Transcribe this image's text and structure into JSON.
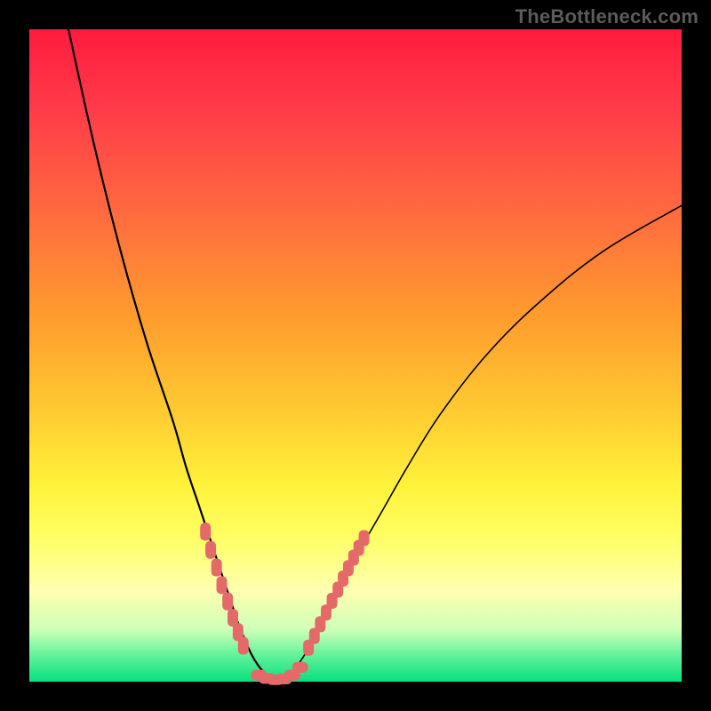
{
  "watermark": {
    "text": "TheBottleneck.com"
  },
  "colors": {
    "gradient_top": "#ff1b3e",
    "gradient_bottom": "#07e07f",
    "curve_stroke": "#000000",
    "marker_fill": "#e46a6a",
    "frame_bg": "#000000"
  },
  "chart_data": {
    "type": "line",
    "title": "",
    "xlabel": "",
    "ylabel": "",
    "xlim": [
      0,
      100
    ],
    "ylim": [
      0,
      100
    ],
    "grid": false,
    "legend": false,
    "comment": "Stylized bottleneck V-curve. Values estimated from pixels; no axis ticks present.",
    "series": [
      {
        "name": "curve-left",
        "x": [
          6,
          10,
          14,
          18,
          22,
          24,
          26,
          28,
          30,
          31,
          32,
          33,
          34,
          35,
          36,
          37,
          38
        ],
        "y": [
          100,
          82,
          66,
          52,
          40,
          33,
          27,
          21,
          15,
          12,
          9,
          6.5,
          4.3,
          2.6,
          1.4,
          0.6,
          0.2
        ]
      },
      {
        "name": "curve-right",
        "x": [
          38,
          40,
          42,
          44,
          47,
          50,
          54,
          58,
          63,
          70,
          78,
          88,
          100
        ],
        "y": [
          0.2,
          1.2,
          3.8,
          7.5,
          13,
          19,
          26,
          33,
          41,
          50,
          58,
          66,
          73
        ]
      }
    ],
    "markers": {
      "name": "dotted-overlay",
      "shape": "rounded-rect",
      "color": "#e46a6a",
      "left_branch": {
        "x": [
          27.0,
          27.8,
          28.7,
          29.5,
          30.4,
          31.2,
          32.0,
          32.8
        ],
        "y": [
          23.0,
          20.2,
          17.5,
          14.8,
          12.3,
          9.8,
          7.6,
          5.5
        ]
      },
      "bottom": {
        "x": [
          35.2,
          36.4,
          37.7,
          39.0,
          40.3,
          41.5
        ],
        "y": [
          1.0,
          0.5,
          0.3,
          0.4,
          1.0,
          2.2
        ]
      },
      "right_branch": {
        "x": [
          42.8,
          43.7,
          44.6,
          45.5,
          46.4,
          47.3,
          48.1,
          48.9,
          49.7,
          50.5,
          51.3
        ],
        "y": [
          5.2,
          7.0,
          8.8,
          10.6,
          12.4,
          14.1,
          15.8,
          17.4,
          19.0,
          20.5,
          22.0
        ]
      }
    }
  }
}
